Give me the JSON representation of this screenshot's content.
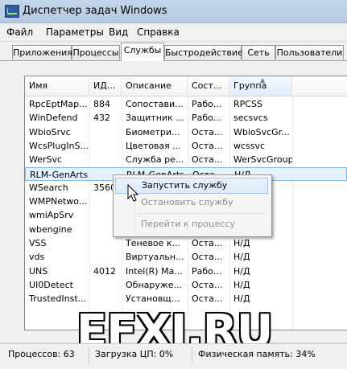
{
  "window": {
    "title": "Диспетчер задач Windows"
  },
  "menu": [
    "Файл",
    "Параметры",
    "Вид",
    "Справка"
  ],
  "tabs": [
    "Приложения",
    "Процессы",
    "Службы",
    "Быстродействие",
    "Сеть",
    "Пользователи"
  ],
  "active_tab": "Службы",
  "columns": [
    "Имя",
    "ИД...",
    "Описание",
    "Сост...",
    "Группа"
  ],
  "sorted_column": "Группа",
  "rows": [
    {
      "name": "RpcEptMap...",
      "pid": "884",
      "desc": "Сопостави...",
      "state": "Рабо...",
      "group": "RPCSS"
    },
    {
      "name": "WinDefend",
      "pid": "432",
      "desc": "Защитник ...",
      "state": "Рабо...",
      "group": "secsvcs"
    },
    {
      "name": "WbioSrvc",
      "pid": "",
      "desc": "Биометри...",
      "state": "Оста...",
      "group": "WbioSvcGr..."
    },
    {
      "name": "WcsPlugInS...",
      "pid": "",
      "desc": "Цветовая ...",
      "state": "Оста...",
      "group": "wcssvc"
    },
    {
      "name": "WerSvc",
      "pid": "",
      "desc": "Служба ре...",
      "state": "Оста...",
      "group": "WerSvcGroup"
    },
    {
      "name": "RLM-GenArts",
      "pid": "",
      "desc": "RLM-GenArts",
      "state": "Оста...",
      "group": "Н/Д"
    },
    {
      "name": "WSearch",
      "pid": "3560",
      "desc": "",
      "state": "",
      "group": ""
    },
    {
      "name": "WMPNetwo...",
      "pid": "",
      "desc": "",
      "state": "",
      "group": ""
    },
    {
      "name": "wmiApSrv",
      "pid": "",
      "desc": "",
      "state": "",
      "group": ""
    },
    {
      "name": "wbengine",
      "pid": "",
      "desc": "",
      "state": "",
      "group": ""
    },
    {
      "name": "VSS",
      "pid": "",
      "desc": "Теневое к...",
      "state": "Оста...",
      "group": "Н/Д"
    },
    {
      "name": "vds",
      "pid": "",
      "desc": "Виртуальн...",
      "state": "Оста...",
      "group": "Н/Д"
    },
    {
      "name": "UNS",
      "pid": "4012",
      "desc": "Intel(R) Ma...",
      "state": "Рабо...",
      "group": "Н/Д"
    },
    {
      "name": "UI0Detect",
      "pid": "",
      "desc": "Обнаруже...",
      "state": "Оста...",
      "group": "Н/Д"
    },
    {
      "name": "TrustedInst...",
      "pid": "",
      "desc": "Установщ...",
      "state": "Оста...",
      "group": "Н/Д"
    }
  ],
  "selected_row": "RLM-GenArts",
  "context_menu": {
    "items": [
      {
        "label": "Запустить службу",
        "enabled": true,
        "hover": true
      },
      {
        "label": "Остановить службу",
        "enabled": false
      },
      {
        "label": "Перейти к процессу",
        "enabled": false
      }
    ]
  },
  "watermark": "EFXI.RU",
  "status": {
    "processes": "Процессов: 63",
    "cpu": "Загрузка ЦП: 0%",
    "memory": "Физическая память: 34%"
  }
}
